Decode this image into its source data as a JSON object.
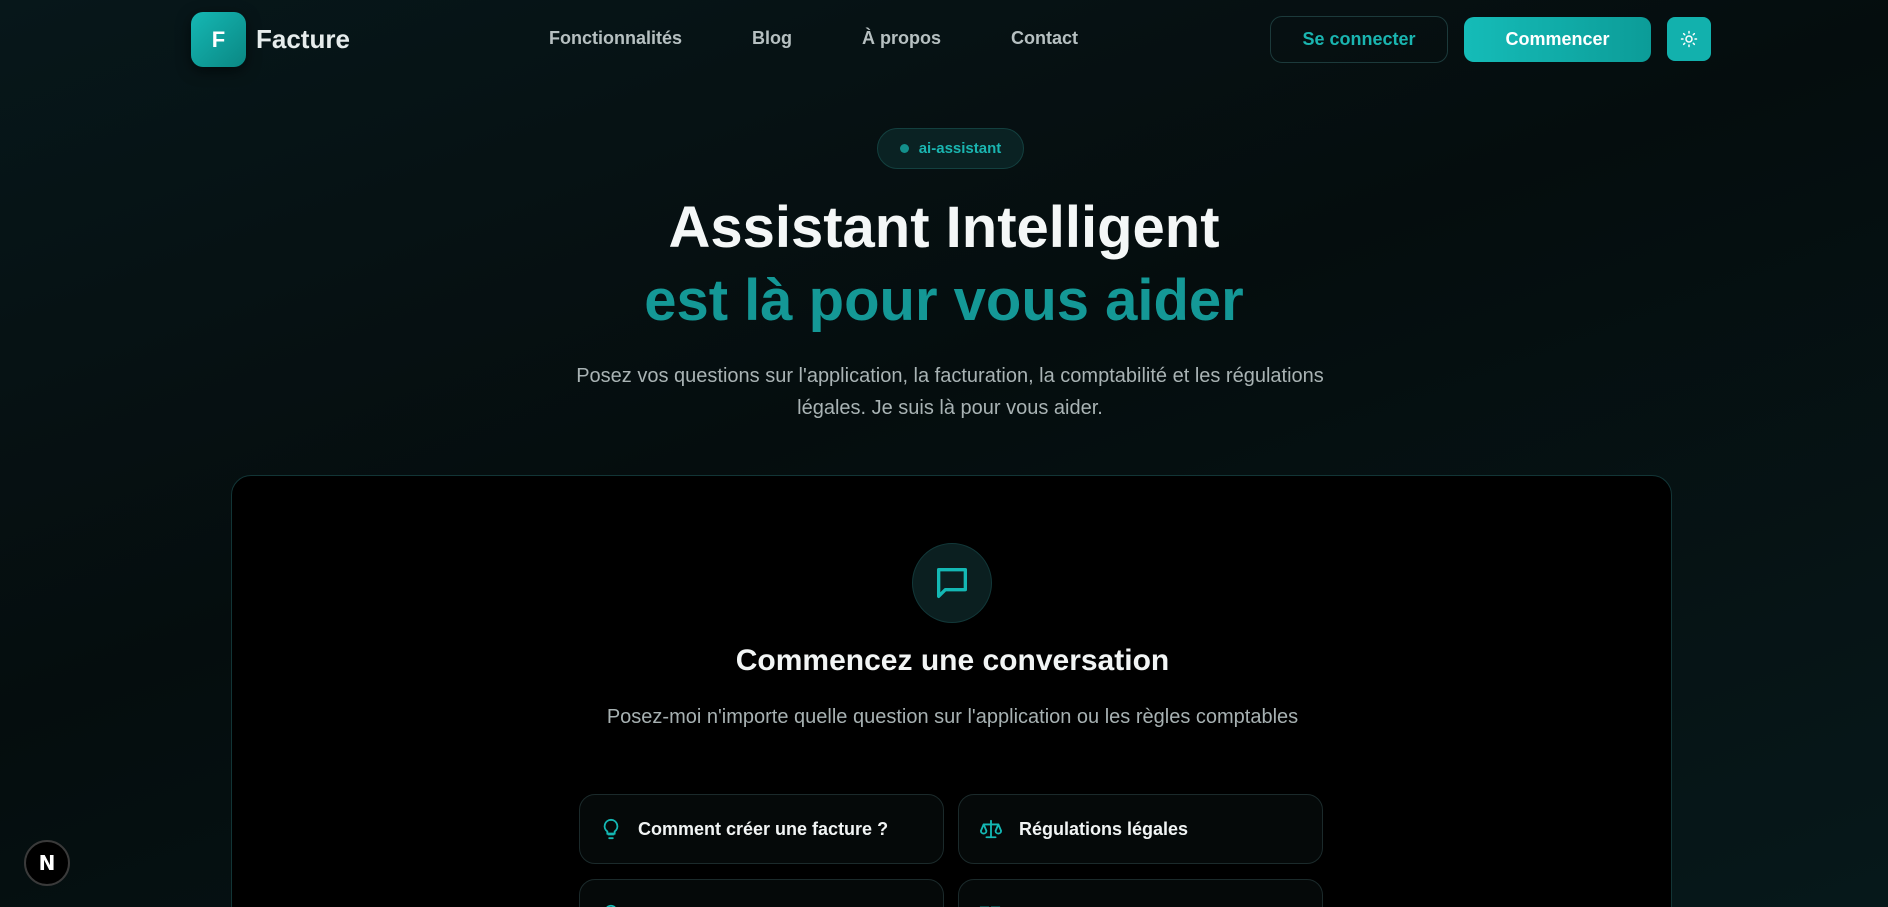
{
  "nav": {
    "logo_letter": "F",
    "brand": "Facture",
    "links": [
      "Fonctionnalités",
      "Blog",
      "À propos",
      "Contact"
    ],
    "login_label": "Se connecter",
    "start_label": "Commencer",
    "theme_icon": "sun-icon"
  },
  "hero": {
    "badge": "ai-assistant",
    "title_line1": "Assistant Intelligent",
    "title_line2": "est là pour vous aider",
    "subtitle": "Posez vos questions sur l'application, la facturation, la comptabilité et les régulations légales. Je suis là pour vous aider."
  },
  "chat": {
    "icon": "message-square-icon",
    "title": "Commencez une conversation",
    "subtitle": "Posez-moi n'importe quelle question sur l'application ou les règles comptables",
    "suggestions": [
      {
        "label": "Comment créer une facture ?",
        "icon": "lightbulb-icon"
      },
      {
        "label": "Régulations légales",
        "icon": "scale-icon"
      },
      {
        "label": "",
        "icon": "lightbulb-icon"
      },
      {
        "label": "",
        "icon": "book-icon"
      }
    ]
  },
  "dev_badge": {
    "letter": "N"
  },
  "colors": {
    "accent": "#14b8b4",
    "accent_dark": "#149896",
    "background": "#061112",
    "panel": "#000000"
  }
}
